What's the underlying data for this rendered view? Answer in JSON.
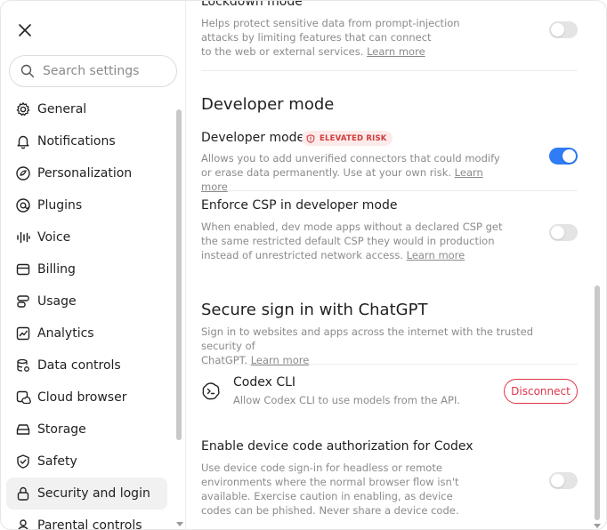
{
  "sidebar": {
    "search_placeholder": "Search settings",
    "items": [
      {
        "label": "General",
        "icon": "gear-icon"
      },
      {
        "label": "Notifications",
        "icon": "bell-icon"
      },
      {
        "label": "Personalization",
        "icon": "personalization-icon"
      },
      {
        "label": "Plugins",
        "icon": "plugins-icon"
      },
      {
        "label": "Voice",
        "icon": "voice-waveform-icon"
      },
      {
        "label": "Billing",
        "icon": "billing-card-icon"
      },
      {
        "label": "Usage",
        "icon": "usage-icon"
      },
      {
        "label": "Analytics",
        "icon": "analytics-chart-icon"
      },
      {
        "label": "Data controls",
        "icon": "database-icon"
      },
      {
        "label": "Cloud browser",
        "icon": "cloud-browser-icon"
      },
      {
        "label": "Storage",
        "icon": "storage-drive-icon"
      },
      {
        "label": "Safety",
        "icon": "shield-icon"
      },
      {
        "label": "Security and login",
        "icon": "lock-icon",
        "active": true
      },
      {
        "label": "Parental controls",
        "icon": "person-icon"
      }
    ]
  },
  "main": {
    "lockdown": {
      "title": "Lockdown mode",
      "desc_line1": "Helps protect sensitive data from prompt-injection",
      "desc_line2": "attacks by limiting features that can connect",
      "desc_line3": "to the web or external services. ",
      "learn_more": "Learn more",
      "enabled": false
    },
    "developer_section_title": "Developer mode",
    "developer_mode": {
      "title": "Developer mode",
      "badge": "ELEVATED RISK",
      "desc_line1": "Allows you to add unverified connectors that could modify",
      "desc_line2": "or erase data permanently. Use at your own risk. ",
      "learn_more": "Learn more",
      "enabled": true
    },
    "enforce_csp": {
      "title": "Enforce CSP in developer mode",
      "desc_line1": "When enabled, dev mode apps without a declared CSP get",
      "desc_line2": "the same restricted default CSP they would in production",
      "desc_line3": "instead of unrestricted network access. ",
      "learn_more": "Learn more",
      "enabled": false
    },
    "secure_signin": {
      "title": "Secure sign in with ChatGPT",
      "desc_line1": "Sign in to websites and apps across the internet with the trusted security of",
      "desc_line2": "ChatGPT. ",
      "learn_more": "Learn more"
    },
    "codex_cli": {
      "title": "Codex CLI",
      "desc": "Allow Codex CLI to use models from the API.",
      "button": "Disconnect"
    },
    "device_code": {
      "title": "Enable device code authorization for Codex",
      "desc_line1": "Use device code sign-in for headless or remote",
      "desc_line2": "environments where the normal browser flow isn't",
      "desc_line3": "available. Exercise caution in enabling, as device",
      "desc_line4": "codes can be phished. Never share a device code.",
      "enabled": false
    }
  },
  "colors": {
    "accent": "#2f7cf6",
    "danger": "#e0344a",
    "badge_bg": "#fdeaea",
    "muted_text": "#8b8b8b"
  }
}
